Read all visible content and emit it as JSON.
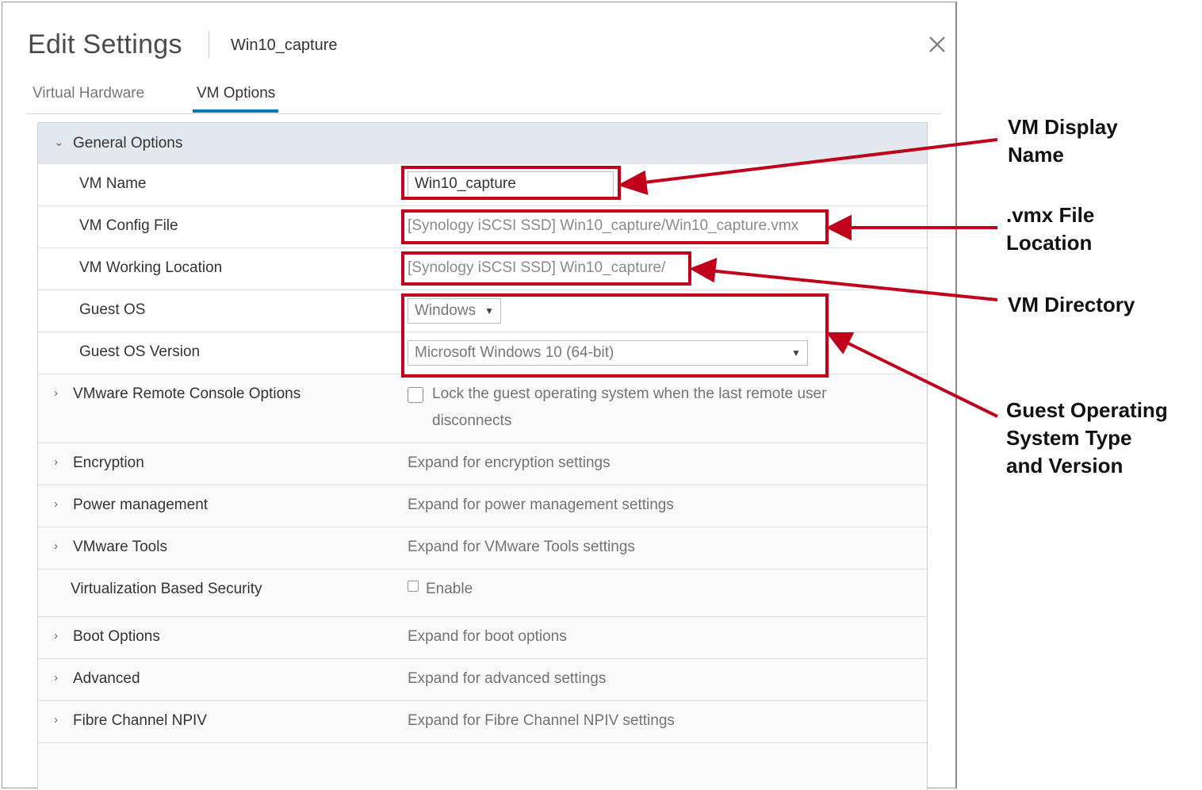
{
  "dialog": {
    "title": "Edit Settings",
    "subtitle": "Win10_capture",
    "close_icon": "close-icon"
  },
  "tabs": [
    {
      "label": "Virtual Hardware",
      "active": false
    },
    {
      "label": "VM Options",
      "active": true
    }
  ],
  "section": {
    "header": "General Options",
    "rows": {
      "vm_name": {
        "label": "VM Name",
        "value": "Win10_capture"
      },
      "config_file": {
        "label": "VM Config File",
        "value": "[Synology iSCSI SSD] Win10_capture/Win10_capture.vmx"
      },
      "working_location": {
        "label": "VM Working Location",
        "value": "[Synology iSCSI SSD] Win10_capture/"
      },
      "guest_os": {
        "label": "Guest OS",
        "value": "Windows"
      },
      "guest_os_version": {
        "label": "Guest OS Version",
        "value": "Microsoft Windows 10 (64-bit)"
      }
    }
  },
  "options": [
    {
      "label": "VMware Remote Console Options",
      "value_line1": "Lock the guest operating system when the last remote user",
      "value_line2": "disconnects"
    },
    {
      "label": "Encryption",
      "value": "Expand for encryption settings"
    },
    {
      "label": "Power management",
      "value": "Expand for power management settings"
    },
    {
      "label": "VMware Tools",
      "value": "Expand for VMware Tools settings"
    },
    {
      "label": "Virtualization Based Security",
      "value": "Enable"
    },
    {
      "label": "Boot Options",
      "value": "Expand for boot options"
    },
    {
      "label": "Advanced",
      "value": "Expand for advanced settings"
    },
    {
      "label": "Fibre Channel NPIV",
      "value": "Expand for Fibre Channel NPIV settings"
    }
  ],
  "annotations": {
    "display_name": [
      "VM Display",
      "Name"
    ],
    "vmx_location": [
      ".vmx File",
      "Location"
    ],
    "vm_directory": [
      "VM Directory"
    ],
    "guest_os": [
      "Guest Operating",
      "System Type",
      "and Version"
    ],
    "highlight_color": "#c0001a"
  }
}
